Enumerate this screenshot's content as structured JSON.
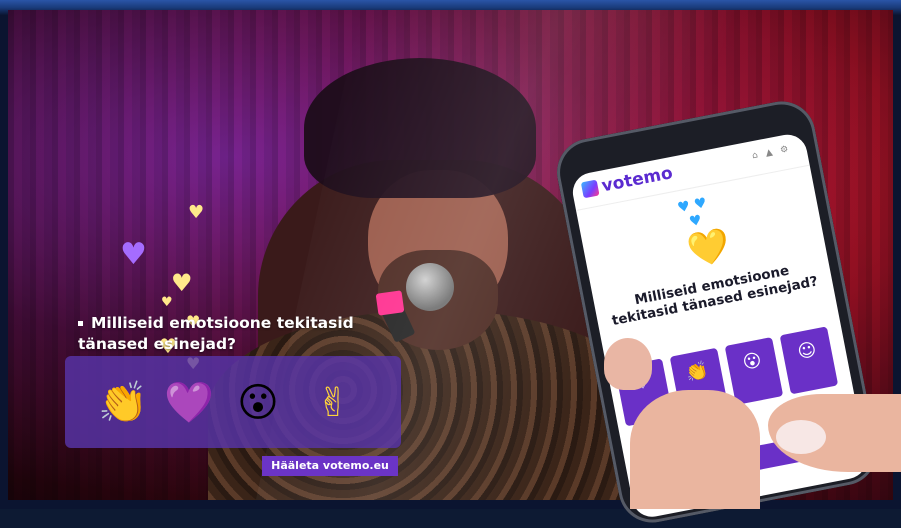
{
  "overlay": {
    "question": "Milliseid emotsioone tekitasid tänased esinejad?",
    "cta": "Hääleta votemo.eu",
    "emotions": [
      {
        "icon": "clapping-hands-icon",
        "glyph": "👏"
      },
      {
        "icon": "heart-icon",
        "glyph": "💜"
      },
      {
        "icon": "surprised-face-icon",
        "glyph": "😮"
      },
      {
        "icon": "peace-face-icon",
        "glyph": "✌"
      }
    ]
  },
  "phone": {
    "brand": "votemo",
    "question": "Milliseid emotsioone tekitasid tänased esinejad?",
    "options": [
      {
        "icon": "heart-outline-icon",
        "glyph": "♡"
      },
      {
        "icon": "clapping-hands-icon",
        "glyph": "👏"
      },
      {
        "icon": "surprised-face-icon",
        "glyph": "😮"
      },
      {
        "icon": "peace-face-icon",
        "glyph": "☺"
      }
    ]
  },
  "colors": {
    "accent": "#6b34c6",
    "panel": "#5834a8",
    "emoji_yellow": "#ffd43b",
    "heart_purple": "#a56cff"
  }
}
